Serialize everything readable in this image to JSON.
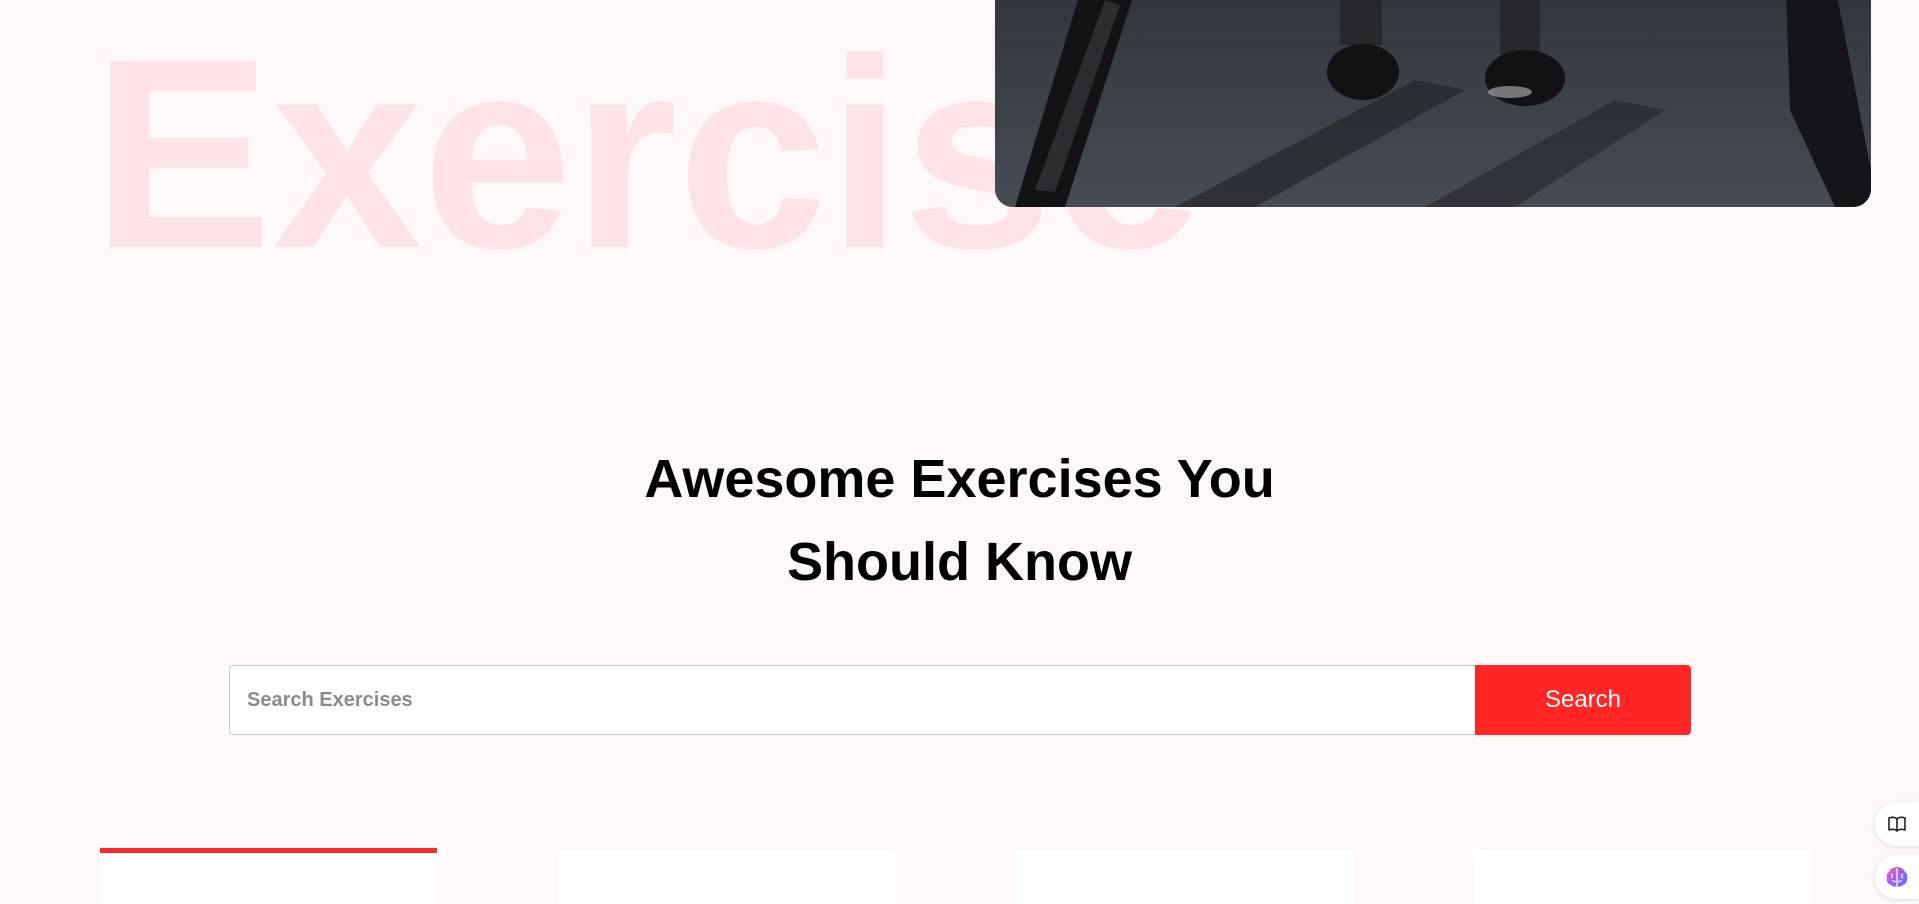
{
  "background_word": "Exercise",
  "hero": {
    "image_alt": "gym-floor-legs-photo"
  },
  "heading": {
    "line1": "Awesome Exercises You",
    "line2": "Should Know"
  },
  "search": {
    "placeholder": "Search Exercises",
    "value": "",
    "button_label": "Search"
  },
  "categories": {
    "count_visible": 4,
    "active_index": 0
  },
  "floating_widgets": [
    {
      "name": "book-icon"
    },
    {
      "name": "brain-icon"
    }
  ],
  "colors": {
    "accent": "#ff2625",
    "background": "#fff8f9",
    "background_word": "#fde3e5",
    "heading": "#000000"
  }
}
